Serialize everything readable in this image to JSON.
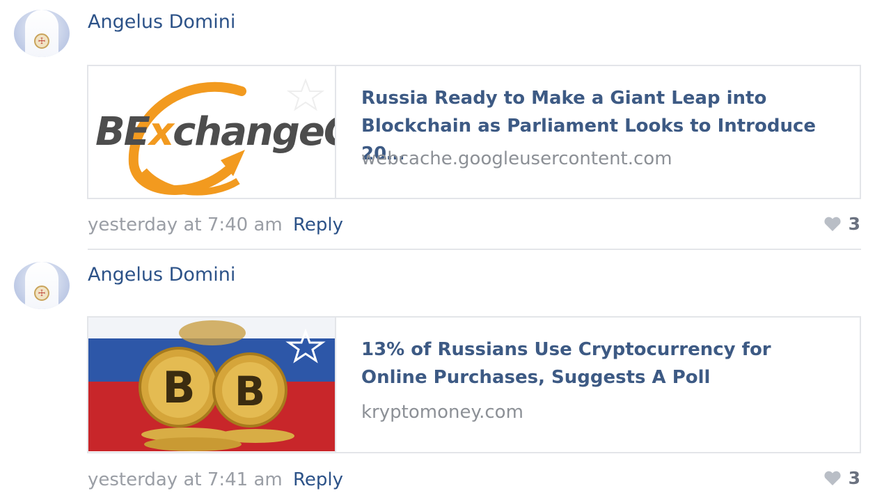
{
  "comments": [
    {
      "author": "Angelus Domini",
      "link": {
        "title": "Russia Ready to Make a Giant Leap into Blockchain as Parliament Looks to Introduce 20…",
        "domain": "webcache.googleusercontent.com",
        "thumb_text": {
          "pre": "BE",
          "x": "x",
          "post": "changeG"
        }
      },
      "time": "yesterday at 7:40 am",
      "reply": "Reply",
      "likes": "3"
    },
    {
      "author": "Angelus Domini",
      "link": {
        "title": "13% of Russians Use Cryptocurrency for Online Purchases, Suggests A Poll",
        "domain": "kryptomoney.com"
      },
      "time": "yesterday at 7:41 am",
      "reply": "Reply",
      "likes": "3"
    }
  ],
  "icons": {
    "heart": "heart-icon",
    "bookmark": "star-icon"
  },
  "colors": {
    "link_title": "#3d5a84",
    "author": "#2c5288",
    "meta": "#9a9ea5",
    "orange": "#f29a1f"
  }
}
